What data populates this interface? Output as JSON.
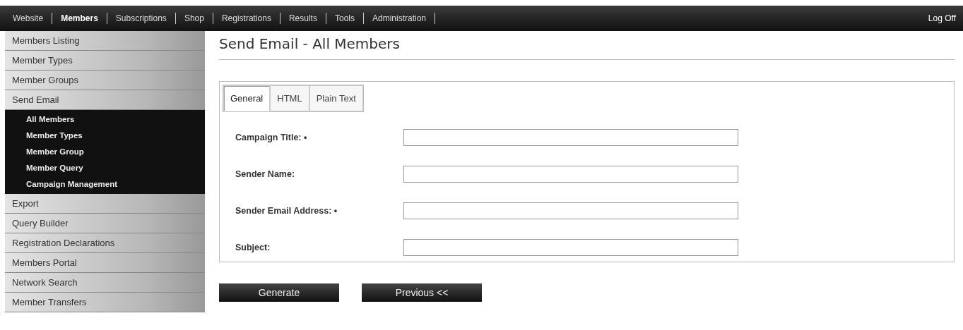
{
  "nav": {
    "items": [
      {
        "label": "Website",
        "selected": false
      },
      {
        "label": "Members",
        "selected": true
      },
      {
        "label": "Subscriptions",
        "selected": false
      },
      {
        "label": "Shop",
        "selected": false
      },
      {
        "label": "Registrations",
        "selected": false
      },
      {
        "label": "Results",
        "selected": false
      },
      {
        "label": "Tools",
        "selected": false
      },
      {
        "label": "Administration",
        "selected": false
      }
    ],
    "logoff": "Log Off"
  },
  "sidebar": {
    "items": [
      {
        "label": "Members Listing"
      },
      {
        "label": "Member Types"
      },
      {
        "label": "Member Groups"
      },
      {
        "label": "Send Email",
        "children": [
          {
            "label": "All Members"
          },
          {
            "label": "Member Types"
          },
          {
            "label": "Member Group"
          },
          {
            "label": "Member Query"
          },
          {
            "label": "Campaign Management"
          }
        ]
      },
      {
        "label": "Export"
      },
      {
        "label": "Query Builder"
      },
      {
        "label": "Registration Declarations"
      },
      {
        "label": "Members Portal"
      },
      {
        "label": "Network Search"
      },
      {
        "label": "Member Transfers"
      }
    ]
  },
  "page_title": "Send Email - All Members",
  "tabs": [
    {
      "label": "General",
      "selected": true
    },
    {
      "label": "HTML",
      "selected": false
    },
    {
      "label": "Plain Text",
      "selected": false
    }
  ],
  "fields": [
    {
      "label": "Campaign Title: •"
    },
    {
      "label": "Sender Name:"
    },
    {
      "label": "Sender Email Address: •"
    },
    {
      "label": "Subject:"
    }
  ],
  "buttons": [
    "Generate",
    "Previous <<"
  ]
}
